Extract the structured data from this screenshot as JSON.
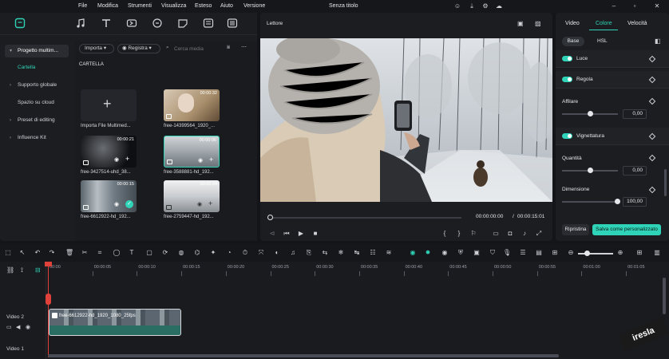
{
  "menu": [
    "File",
    "Modifica",
    "Strumenti",
    "Visualizza",
    "Esteso",
    "Aiuto",
    "Versione"
  ],
  "window_title": "Senza titolo",
  "media": {
    "nav": [
      {
        "label": "Progetto multim...",
        "active": true
      },
      {
        "label": "Cartella",
        "selected": true
      },
      {
        "label": "Supporto globale"
      },
      {
        "label": "Spazio su cloud"
      },
      {
        "label": "Preset di editing"
      },
      {
        "label": "Influence Kit"
      }
    ],
    "import_label": "Importa",
    "record_label": "Registra",
    "search_placeholder": "Cerca media",
    "folder_header": "CARTELLA",
    "items": [
      {
        "label": "Importa File Multimed...",
        "duration": ""
      },
      {
        "label": "free-14399564_1920_...",
        "duration": "00:00:32"
      },
      {
        "label": "free-3427514-uhd_38...",
        "duration": "00:00:21"
      },
      {
        "label": "free-3588881-hd_192...",
        "duration": "00:00:06"
      },
      {
        "label": "free-6612922-hd_192...",
        "duration": "00:00:15"
      },
      {
        "label": "free-2759447-hd_192...",
        "duration": "00:00:04"
      }
    ]
  },
  "player": {
    "label": "Lettore",
    "current_time": "00:00:00:00",
    "separator": "/",
    "total_time": "00:00:15:01"
  },
  "inspector": {
    "tabs": [
      "Video",
      "Colore",
      "Velocità"
    ],
    "active_tab": "Colore",
    "subtabs": [
      "Base",
      "HSL"
    ],
    "sections": [
      "Luce",
      "Regola",
      "Vignettatura"
    ],
    "params": [
      {
        "label": "Affilare",
        "value": "0,00"
      },
      {
        "label": "Quantità",
        "value": "0,00"
      },
      {
        "label": "Dimensione",
        "value": "100,00"
      }
    ],
    "reset_label": "Ripristina",
    "save_label": "Salva come personalizzato"
  },
  "timeline": {
    "ruler": [
      "00:00",
      "00:00:05",
      "00:00:10",
      "00:00:15",
      "00:00:20",
      "00:00:25",
      "00:00:30",
      "00:00:35",
      "00:00:40",
      "00:00:45",
      "00:00:50",
      "00:00:55",
      "00:01:00",
      "00:01:05"
    ],
    "tracks": [
      "Video 2",
      "Video 1"
    ],
    "clip_name": "free-6612922-hd_1920_1080_25fps"
  },
  "watermark": "iresla",
  "colors": {
    "accent": "#2fd4b8",
    "playhead": "#e0413a"
  }
}
